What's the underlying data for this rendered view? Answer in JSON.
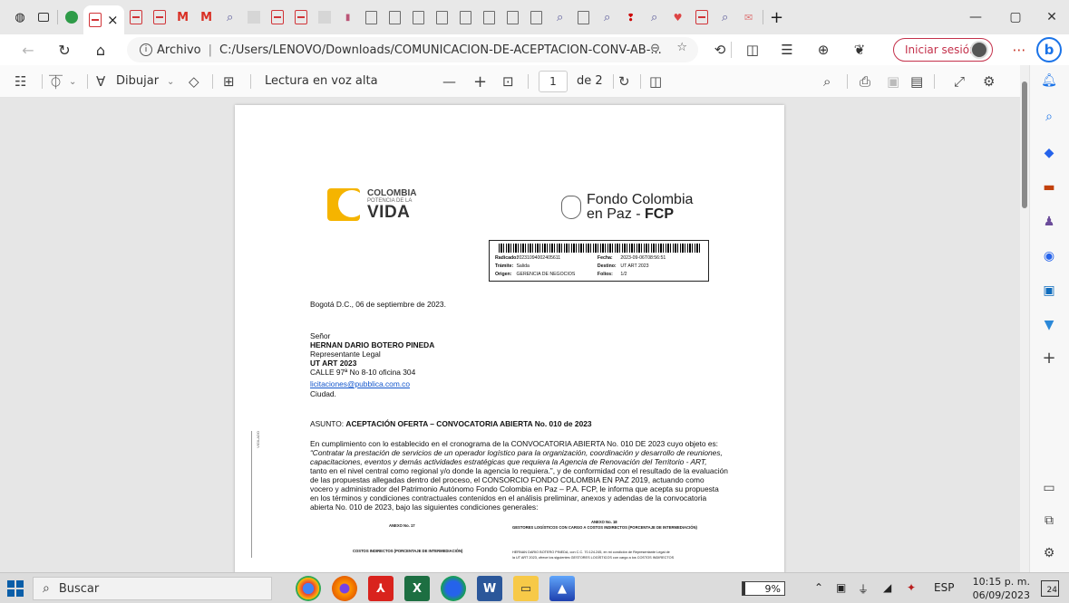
{
  "tabs": {
    "active_close": "×",
    "new_tab": "+"
  },
  "window": {
    "minimize": "—",
    "maximize": "▢",
    "close": "✕"
  },
  "address_bar": {
    "info_icon": "i",
    "scheme_label": "Archivo",
    "url": "C:/Users/LENOVO/Downloads/COMUNICACION-DE-ACEPTACION-CONV-AB-...",
    "signin_label": "Iniciar sesión",
    "bing_label": "b"
  },
  "pdf_toolbar": {
    "draw_label": "Dibujar",
    "read_aloud_label": "Lectura en voz alta",
    "zoom_out": "—",
    "zoom_in": "+",
    "page_current": "1",
    "page_total": "de 2"
  },
  "document": {
    "logo_colombia": {
      "line1": "COLOMBIA",
      "line2": "POTENCIA DE LA",
      "line3": "VIDA"
    },
    "logo_fcp": {
      "line1": "Fondo Colombia",
      "line2_prefix": "en Paz - ",
      "line2_bold": "FCP"
    },
    "radicado": {
      "rows": [
        {
          "k1": "Radicado:",
          "v1": "20231094002405611",
          "k2": "Fecha:",
          "v2": "2023-09-06T08:56:51"
        },
        {
          "k1": "Trámite:",
          "v1": "Salida",
          "k2": "Destino:",
          "v2": "UT ART 2023"
        },
        {
          "k1": "Origen:",
          "v1": "GERENCIA DE NEGOCIOS",
          "k2": "Folios:",
          "v2": "1/2"
        }
      ]
    },
    "date_line": "Bogotá D.C., 06 de septiembre de 2023.",
    "recipient": {
      "salutation": "Señor",
      "name": "HERNAN DARIO BOTERO PINEDA",
      "role": "Representante Legal",
      "company": "UT ART 2023",
      "address": "CALLE 97ª No 8-10 oficina 304",
      "email": "licitaciones@pubblica.com.co",
      "city": "Ciudad."
    },
    "subject_prefix": "ASUNTO: ",
    "subject_bold": "ACEPTACIÓN OFERTA – CONVOCATORIA ABIERTA No. 010 de 2023",
    "paragraph": [
      "En cumplimiento con lo establecido en el cronograma de la CONVOCATORIA ABIERTA No. 010 DE 2023 cuyo objeto es:",
      "“Contratar la prestación de servicios de un operador logístico para la organización, coordinación y desarrollo de reuniones,",
      "capacitaciones, eventos y demás actividades estratégicas que requiera la Agencia de Renovación del Territorio - ART,",
      "tanto en el nivel central como regional y/o donde la agencia lo requiera.”, y de conformidad  con el resultado de la evaluación",
      "de las propuestas allegadas dentro del proceso, el CONSORCIO FONDO COLOMBIA EN PAZ 2019, actuando como",
      "vocero y administrador del Patrimonio Autónomo Fondo Colombia en Paz – P.A. FCP, le informa que acepta su propuesta",
      "en los términos y condiciones contractuales contenidos en el análisis preliminar, anexos y adendas de la convocatoria",
      "abierta No. 010 de 2023, bajo las siguientes condiciones generales:"
    ],
    "annex17_title": "ANEXO No. 17",
    "annex17_sub": "COSTOS INDIRECTOS (PORCENTAJE DE INTERMEDIACIÓN)",
    "annex18_title": "ANEXO No. 18",
    "annex18_sub": "GESTORES LOGÍSTICOS CON CARGO A COSTOS INDIRECTOS (PORCENTAJE DE INTERMEDIACIÓN)",
    "annex18_text": "HERNAN DARIO BOTERO PINEDA, con C.C. 70.124.245, en mi condición de Representante Legal de",
    "annex18_text2": "la UT ART 2023, ofrece los siguientes GESTORES LOGÍSTICOS con cargo a los COSTOS INDIRECTOS",
    "stamp_text": "VIGILADO"
  },
  "taskbar": {
    "search_placeholder": "Buscar",
    "battery": "9%",
    "lang": "ESP",
    "time": "10:15 p. m.",
    "date": "06/09/2023",
    "notifications": "24"
  }
}
